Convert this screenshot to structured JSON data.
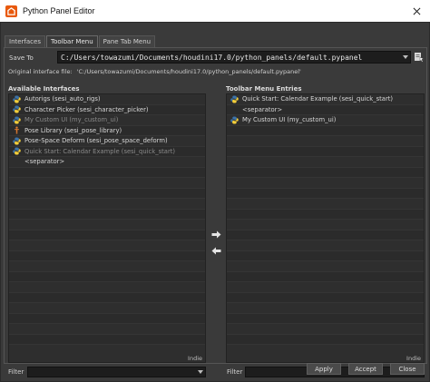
{
  "window": {
    "title": "Python Panel Editor"
  },
  "tabs": [
    {
      "label": "Interfaces",
      "active": false
    },
    {
      "label": "Toolbar Menu",
      "active": true
    },
    {
      "label": "Pane Tab Menu",
      "active": false
    }
  ],
  "save_to": {
    "label": "Save To",
    "value": "C:/Users/towazumi/Documents/houdini17.0/python_panels/default.pypanel"
  },
  "original_file": {
    "label": "Original interface file:",
    "value": "'C:/Users/towazumi/Documents/houdini17.0/python_panels/default.pypanel'"
  },
  "available": {
    "title": "Available Interfaces",
    "items": [
      {
        "label": "Autorigs (sesi_auto_rigs)",
        "icon": "python-icon",
        "dim": false
      },
      {
        "label": "Character Picker (sesi_character_picker)",
        "icon": "python-icon",
        "dim": false
      },
      {
        "label": "My Custom UI (my_custom_ui)",
        "icon": "python-icon",
        "dim": true
      },
      {
        "label": "Pose Library (sesi_pose_library)",
        "icon": "pose-library-icon",
        "dim": false
      },
      {
        "label": "Pose-Space Deform (sesi_pose_space_deform)",
        "icon": "python-icon",
        "dim": false
      },
      {
        "label": "Quick Start: Calendar Example (sesi_quick_start)",
        "icon": "python-icon",
        "dim": true
      },
      {
        "label": "<separator>",
        "icon": "none",
        "dim": false
      }
    ],
    "badge": "Indie"
  },
  "toolbar_entries": {
    "title": "Toolbar Menu Entries",
    "items": [
      {
        "label": "Quick Start: Calendar Example (sesi_quick_start)",
        "icon": "python-icon",
        "dim": false
      },
      {
        "label": "<separator>",
        "icon": "none",
        "dim": false
      },
      {
        "label": "My Custom UI (my_custom_ui)",
        "icon": "python-icon",
        "dim": false
      }
    ],
    "badge": "Indie"
  },
  "filter": {
    "label": "Filter",
    "value": ""
  },
  "buttons": {
    "apply": "Apply",
    "accept": "Accept",
    "close": "Close"
  },
  "colors": {
    "background": "#3a3a3a",
    "list_background": "#2e2e2e",
    "houdini_orange": "#e8590c",
    "python_blue": "#3b72a8",
    "python_yellow": "#f4cf3a"
  }
}
